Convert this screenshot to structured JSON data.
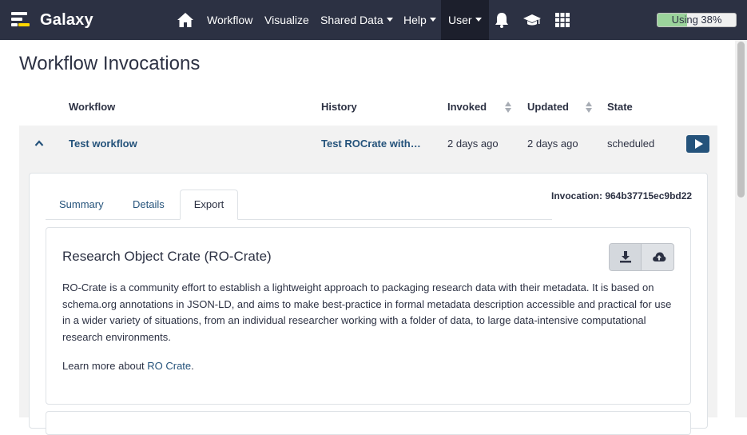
{
  "navbar": {
    "brand": "Galaxy",
    "items": {
      "workflow": "Workflow",
      "visualize": "Visualize",
      "shared_data": "Shared Data",
      "help": "Help",
      "user": "User"
    },
    "icons": [
      "home-icon",
      "bell-icon",
      "graduation-cap-icon",
      "grid-icon"
    ],
    "quota_label": "Using 38%",
    "quota_percent": 38
  },
  "page": {
    "title": "Workflow Invocations"
  },
  "table": {
    "columns": {
      "workflow": "Workflow",
      "history": "History",
      "invoked": "Invoked",
      "updated": "Updated",
      "state": "State"
    },
    "row": {
      "workflow": "Test workflow",
      "history": "Test ROCrate with…",
      "invoked": "2 days ago",
      "updated": "2 days ago",
      "state": "scheduled"
    }
  },
  "details": {
    "invocation_id": "Invocation: 964b37715ec9bd22",
    "tabs": {
      "summary": "Summary",
      "details": "Details",
      "export": "Export"
    },
    "active_tab": "Export",
    "export": {
      "title": "Research Object Crate (RO-Crate)",
      "description": "RO-Crate is a community effort to establish a lightweight approach to packaging research data with their metadata. It is based on schema.org annotations in JSON-LD, and aims to make best-practice in formal metadata description accessible and practical for use in a wider variety of situations, from an individual researcher working with a folder of data, to large data-intensive computational research environments.",
      "learn_prefix": "Learn more about ",
      "learn_link": "RO Crate",
      "learn_suffix": "."
    }
  },
  "colors": {
    "navbar": "#2c3143",
    "link": "#25537b",
    "quota_fill": "#9bd39b"
  }
}
